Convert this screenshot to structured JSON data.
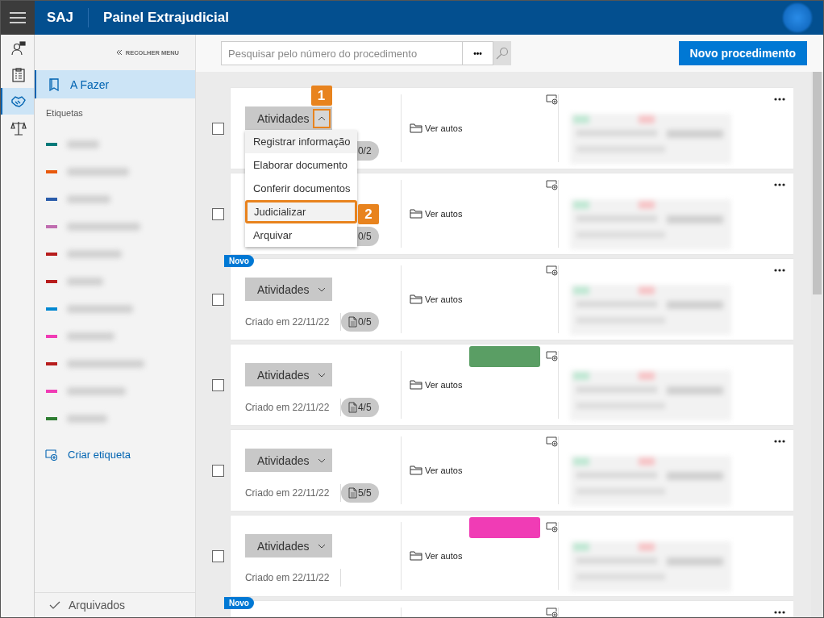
{
  "header": {
    "app": "SAJ",
    "title": "Painel Extrajudicial"
  },
  "rail": [
    {
      "kind": "person",
      "selected": false
    },
    {
      "kind": "checklist",
      "selected": false
    },
    {
      "kind": "handshake",
      "selected": true
    },
    {
      "kind": "scales",
      "selected": false
    }
  ],
  "sidebar": {
    "collapse": "RECOLHER MENU",
    "items": [
      {
        "label": "A Fazer",
        "selected": true
      }
    ],
    "tags_heading": "Etiquetas",
    "tags": [
      {
        "color": "#007a7a"
      },
      {
        "color": "#e8590c"
      },
      {
        "color": "#2a5caa"
      },
      {
        "color": "#c06db0"
      },
      {
        "color": "#b71c1c"
      },
      {
        "color": "#b71c1c"
      },
      {
        "color": "#0288d1"
      },
      {
        "color": "#f03cb5"
      },
      {
        "color": "#b71c1c"
      },
      {
        "color": "#f03cb5"
      },
      {
        "color": "#2e7d32"
      }
    ],
    "create_tag": "Criar etiqueta",
    "archived": "Arquivados"
  },
  "toolbar": {
    "search_placeholder": "Pesquisar pelo número do procedimento",
    "more": "•••",
    "new_button": "Novo procedimento"
  },
  "cards": [
    {
      "checked": false,
      "button": "Atividades",
      "menu_open": true,
      "callout": "1",
      "count": "0/2",
      "link": "Ver autos",
      "more": true,
      "details": true
    },
    {
      "checked": false,
      "count": "0/5",
      "link": "Ver autos",
      "more": true,
      "details": true
    },
    {
      "badge": "Novo",
      "checked": false,
      "button": "Atividades",
      "menu_open": false,
      "created": "Criado em 22/11/22",
      "count": "0/5",
      "link": "Ver autos",
      "more": true,
      "details": true
    },
    {
      "checked": false,
      "button": "Atividades",
      "menu_open": false,
      "created": "Criado em 22/11/22",
      "count": "4/5",
      "link": "Ver autos",
      "tag": {
        "color": "#5a9e64"
      },
      "more": false,
      "details": true
    },
    {
      "checked": false,
      "button": "Atividades",
      "menu_open": false,
      "created": "Criado em 22/11/22",
      "count": "5/5",
      "link": "Ver autos",
      "more": true,
      "details": true
    },
    {
      "checked": false,
      "button": "Atividades",
      "menu_open": false,
      "created": "Criado em 22/11/22",
      "link": "Ver autos",
      "tag": {
        "color": "#f03cb5"
      },
      "more": false,
      "details": true
    },
    {
      "badge": "Novo",
      "more": true,
      "details": false
    }
  ],
  "menu": {
    "items": [
      {
        "label": "Registrar informação",
        "hovered": true
      },
      {
        "label": "Elaborar documento",
        "hovered": false
      },
      {
        "label": "Conferir documentos",
        "hovered": false
      },
      {
        "label": "Judicializar",
        "hovered": true,
        "callout": "2"
      },
      {
        "label": "Arquivar",
        "hovered": false
      }
    ]
  }
}
